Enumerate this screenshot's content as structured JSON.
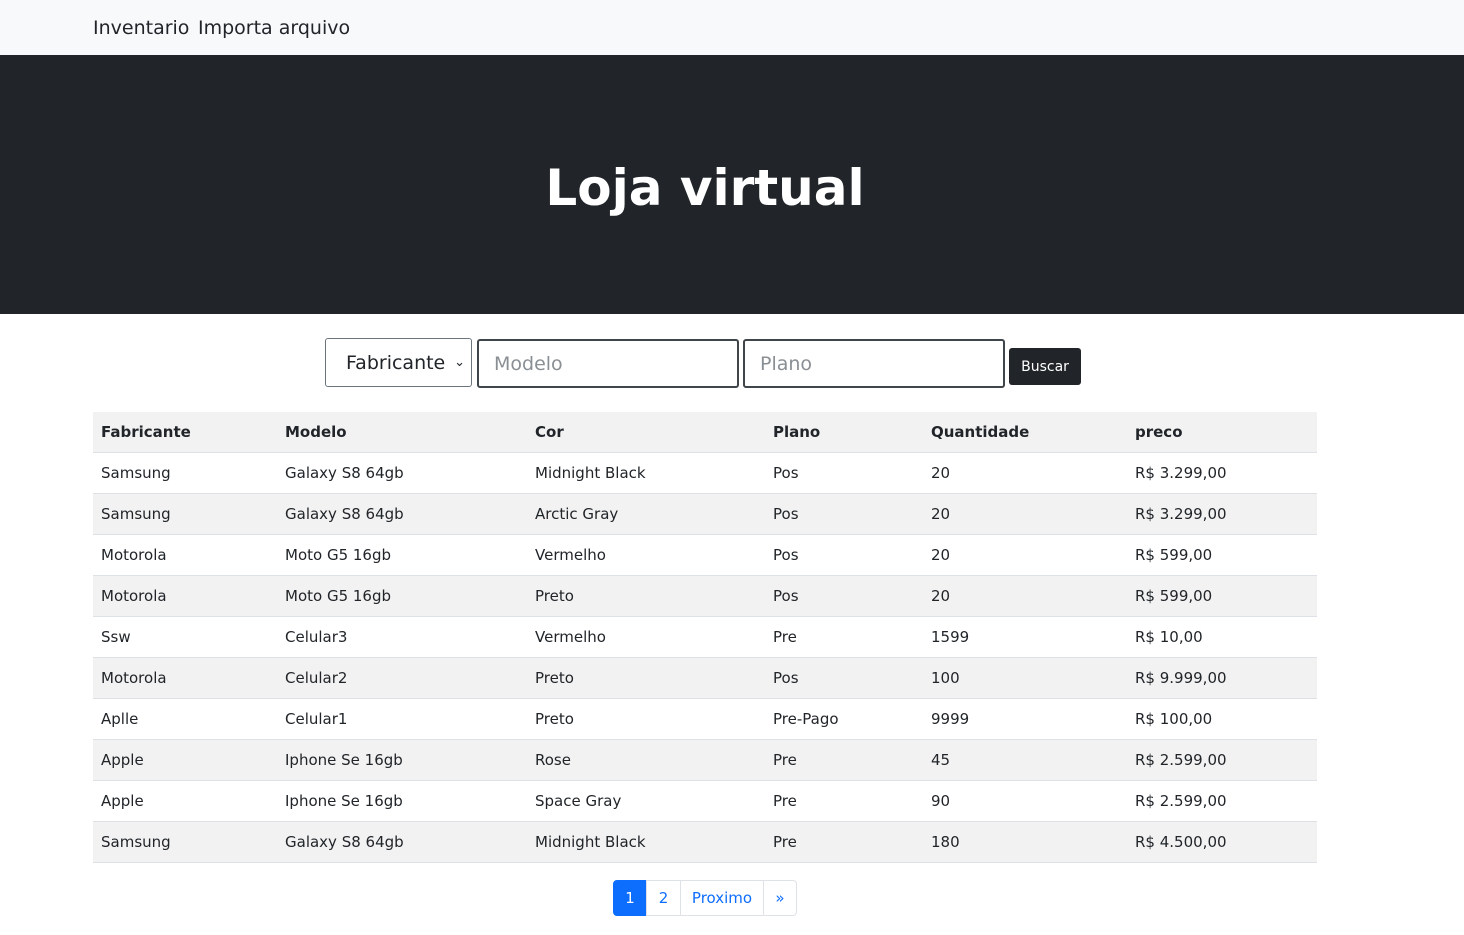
{
  "nav": {
    "items": [
      {
        "label": "Inventario"
      },
      {
        "label": "Importa arquivo"
      }
    ]
  },
  "hero": {
    "title": "Loja virtual"
  },
  "search": {
    "fabricante_selected": "Fabricante",
    "modelo_placeholder": "Modelo",
    "plano_placeholder": "Plano",
    "buscar_label": "Buscar"
  },
  "table": {
    "columns": [
      "Fabricante",
      "Modelo",
      "Cor",
      "Plano",
      "Quantidade",
      "preco"
    ],
    "rows": [
      [
        "Samsung",
        "Galaxy S8 64gb",
        "Midnight Black",
        "Pos",
        "20",
        "R$ 3.299,00"
      ],
      [
        "Samsung",
        "Galaxy S8 64gb",
        "Arctic Gray",
        "Pos",
        "20",
        "R$ 3.299,00"
      ],
      [
        "Motorola",
        "Moto G5 16gb",
        "Vermelho",
        "Pos",
        "20",
        "R$ 599,00"
      ],
      [
        "Motorola",
        "Moto G5 16gb",
        "Preto",
        "Pos",
        "20",
        "R$ 599,00"
      ],
      [
        "Ssw",
        "Celular3",
        "Vermelho",
        "Pre",
        "1599",
        "R$ 10,00"
      ],
      [
        "Motorola",
        "Celular2",
        "Preto",
        "Pos",
        "100",
        "R$ 9.999,00"
      ],
      [
        "Aplle",
        "Celular1",
        "Preto",
        "Pre-Pago",
        "9999",
        "R$ 100,00"
      ],
      [
        "Apple",
        "Iphone Se 16gb",
        "Rose",
        "Pre",
        "45",
        "R$ 2.599,00"
      ],
      [
        "Apple",
        "Iphone Se 16gb",
        "Space Gray",
        "Pre",
        "90",
        "R$ 2.599,00"
      ],
      [
        "Samsung",
        "Galaxy S8 64gb",
        "Midnight Black",
        "Pre",
        "180",
        "R$ 4.500,00"
      ]
    ]
  },
  "pagination": {
    "pages": [
      {
        "label": "1",
        "active": true
      },
      {
        "label": "2",
        "active": false
      }
    ],
    "next_label": "Proximo",
    "last_label": "»"
  },
  "colors": {
    "hero_bg": "#212529",
    "navbar_bg": "#f8f9fa",
    "accent": "#0d6efd",
    "stripe": "#f2f2f2"
  },
  "icons": {
    "select_arrow": "chevron-down-icon"
  }
}
